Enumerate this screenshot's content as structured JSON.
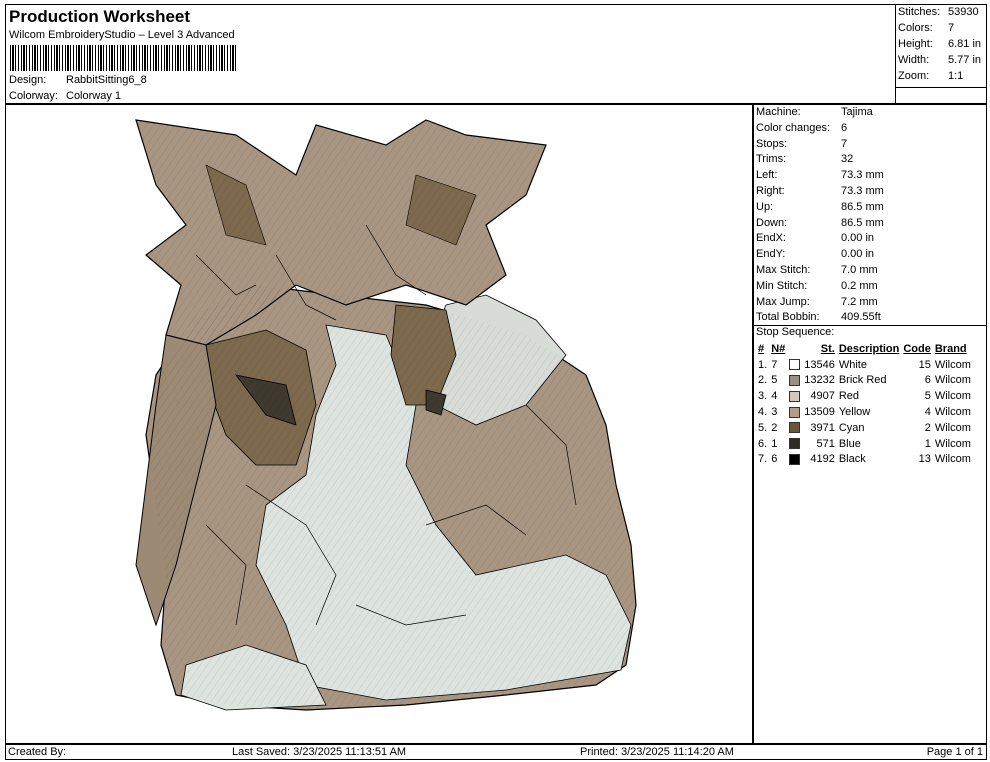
{
  "header": {
    "title": "Production Worksheet",
    "subtitle": "Wilcom EmbroideryStudio – Level 3 Advanced",
    "design_label": "Design:",
    "design_value": "RabbitSitting6_8",
    "colorway_label": "Colorway:",
    "colorway_value": "Colorway 1"
  },
  "stats": [
    {
      "label": "Stitches:",
      "value": "53930"
    },
    {
      "label": "Colors:",
      "value": "7"
    },
    {
      "label": "Height:",
      "value": "6.81 in"
    },
    {
      "label": "Width:",
      "value": "5.77 in"
    },
    {
      "label": "Zoom:",
      "value": "1:1"
    }
  ],
  "machine_info": [
    {
      "label": "Machine:",
      "value": "Tajima"
    },
    {
      "label": "Color changes:",
      "value": "6"
    },
    {
      "label": "Stops:",
      "value": "7"
    },
    {
      "label": "Trims:",
      "value": "32"
    },
    {
      "label": "Left:",
      "value": "73.3 mm"
    },
    {
      "label": "Right:",
      "value": "73.3 mm"
    },
    {
      "label": "Up:",
      "value": "86.5 mm"
    },
    {
      "label": "Down:",
      "value": "86.5 mm"
    },
    {
      "label": "EndX:",
      "value": "0.00 in"
    },
    {
      "label": "EndY:",
      "value": "0.00 in"
    },
    {
      "label": "Max Stitch:",
      "value": "7.0 mm"
    },
    {
      "label": "Min Stitch:",
      "value": "0.2 mm"
    },
    {
      "label": "Max Jump:",
      "value": "7.2 mm"
    },
    {
      "label": "Total Bobbin:",
      "value": "409.55ft"
    }
  ],
  "stop_sequence": {
    "title": "Stop Sequence:",
    "headers": [
      "#",
      "N#",
      "St.",
      "Description",
      "Code",
      "Brand"
    ],
    "rows": [
      {
        "num": "1.",
        "n": "7",
        "color": "#ffffff",
        "st": "13546",
        "desc": "White",
        "code": "15",
        "brand": "Wilcom"
      },
      {
        "num": "2.",
        "n": "5",
        "color": "#9c8d82",
        "st": "13232",
        "desc": "Brick Red",
        "code": "6",
        "brand": "Wilcom"
      },
      {
        "num": "3.",
        "n": "4",
        "color": "#d3c8c0",
        "st": "4907",
        "desc": "Red",
        "code": "5",
        "brand": "Wilcom"
      },
      {
        "num": "4.",
        "n": "3",
        "color": "#b59c88",
        "st": "13509",
        "desc": "Yellow",
        "code": "4",
        "brand": "Wilcom"
      },
      {
        "num": "5.",
        "n": "2",
        "color": "#6a5634",
        "st": "3971",
        "desc": "Cyan",
        "code": "2",
        "brand": "Wilcom"
      },
      {
        "num": "6.",
        "n": "1",
        "color": "#2c2c22",
        "st": "571",
        "desc": "Blue",
        "code": "1",
        "brand": "Wilcom"
      },
      {
        "num": "7.",
        "n": "6",
        "color": "#000000",
        "st": "4192",
        "desc": "Black",
        "code": "13",
        "brand": "Wilcom"
      }
    ]
  },
  "footer": {
    "created_by": "Created By:",
    "last_saved": "Last Saved: 3/23/2025 11:13:51 AM",
    "printed": "Printed: 3/23/2025 11:14:20 AM",
    "page": "Page 1 of 1"
  },
  "colors": {
    "tan": "#a89682",
    "light": "#dde4df",
    "brown": "#7d6a4e",
    "dark": "#3f3a30"
  }
}
